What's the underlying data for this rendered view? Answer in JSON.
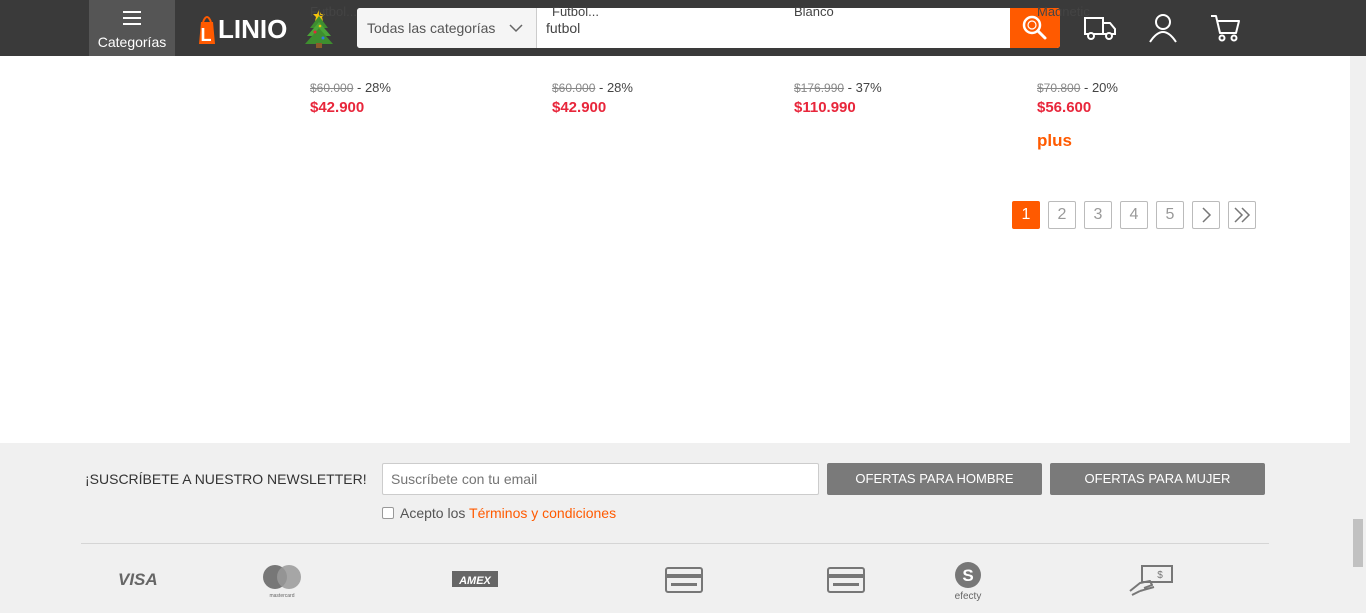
{
  "header": {
    "categories_label": "Categorías",
    "logo_text": "LINIO",
    "category_select": "Todas las categorías",
    "search_value": "futbol"
  },
  "products": [
    {
      "name": "Futbol...",
      "old_price": "$60.000",
      "discount": " - 28%",
      "price": "$42.900",
      "plus": ""
    },
    {
      "name": "Futbol...",
      "old_price": "$60.000",
      "discount": " - 28%",
      "price": "$42.900",
      "plus": ""
    },
    {
      "name": "Blanco",
      "old_price": "$176.990",
      "discount": " - 37%",
      "price": "$110.990",
      "plus": ""
    },
    {
      "name": "Magnetic",
      "old_price": "$70.800",
      "discount": " - 20%",
      "price": "$56.600",
      "plus": "plus"
    }
  ],
  "pagination": {
    "pages": [
      "1",
      "2",
      "3",
      "4",
      "5"
    ],
    "current": "1"
  },
  "footer": {
    "newsletter_label": "¡SUSCRÍBETE A NUESTRO NEWSLETTER!",
    "email_placeholder": "Suscríbete con tu email",
    "men_button": "OFERTAS PARA HOMBRE",
    "women_button": "OFERTAS PARA MUJER",
    "terms_prefix": "Acepto los ",
    "terms_link": "Términos y condiciones",
    "payments": [
      "VISA",
      "mastercard",
      "AMEX",
      "card",
      "card",
      "efecty",
      "cash"
    ]
  },
  "colors": {
    "brand_orange": "#ff5a00",
    "header_bg": "#3a3a3a",
    "price_red": "#e8263b"
  }
}
